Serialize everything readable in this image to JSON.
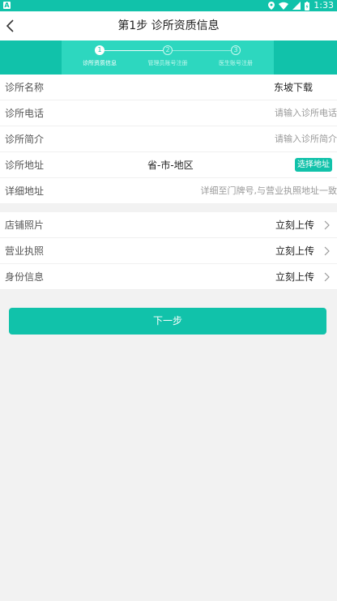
{
  "status_bar": {
    "time": "1:33",
    "app_badge": "A"
  },
  "header": {
    "title": "第1步 诊所资质信息"
  },
  "stepper": {
    "steps": [
      {
        "num": "1",
        "label": "诊所资质信息"
      },
      {
        "num": "2",
        "label": "管理员账号注册"
      },
      {
        "num": "3",
        "label": "医生账号注册"
      }
    ]
  },
  "form": {
    "clinic_name": {
      "label": "诊所名称",
      "value": "东坡下载"
    },
    "clinic_phone": {
      "label": "诊所电话",
      "placeholder": "请输入诊所电话"
    },
    "clinic_intro": {
      "label": "诊所简介",
      "placeholder": "请输入诊所简介"
    },
    "clinic_address": {
      "label": "诊所地址",
      "region": "省-市-地区",
      "button": "选择地址"
    },
    "detail_address": {
      "label": "详细地址",
      "placeholder": "详细至门牌号,与营业执照地址一致"
    },
    "shop_photo": {
      "label": "店铺照片",
      "action": "立刻上传"
    },
    "license": {
      "label": "营业执照",
      "action": "立刻上传"
    },
    "identity": {
      "label": "身份信息",
      "action": "立刻上传"
    }
  },
  "next_button": {
    "label": "下一步"
  },
  "colors": {
    "accent": "#11c2aa",
    "stepper_inner": "#2dd7bf"
  }
}
